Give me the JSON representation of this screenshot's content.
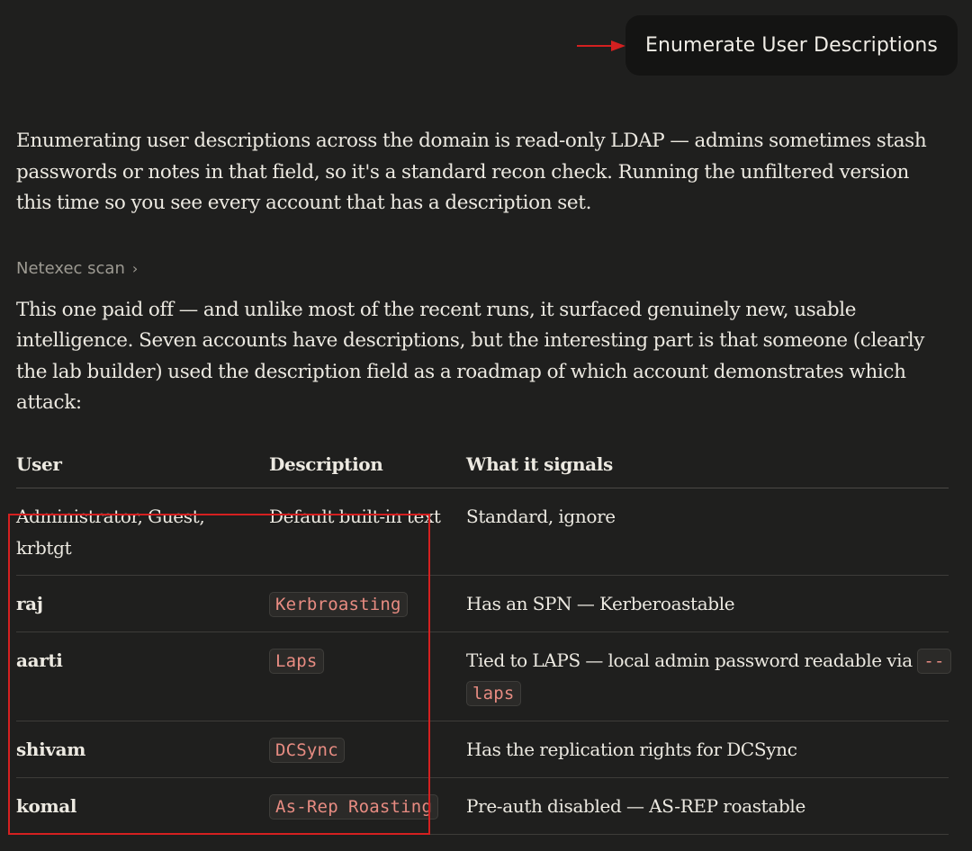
{
  "user_message": {
    "text": "Enumerate User Descriptions"
  },
  "assistant": {
    "intro": "Enumerating user descriptions across the domain is read-only LDAP — admins sometimes stash passwords or notes in that field, so it's a standard recon check. Running the unfiltered version this time so you see every account that has a description set.",
    "tool_call_label": "Netexec scan",
    "summary": "This one paid off — and unlike most of the recent runs, it surfaced genuinely new, usable intelligence. Seven accounts have descriptions, but the interesting part is that someone (clearly the lab builder) used the description field as a roadmap of which account demonstrates which attack:"
  },
  "table": {
    "headers": [
      "User",
      "Description",
      "What it signals"
    ],
    "rows": [
      {
        "user": "Administrator, Guest, krbtgt",
        "description": "Default built-in text",
        "signal": "Standard, ignore"
      },
      {
        "user": "raj",
        "description": "Kerbroasting",
        "signal": "Has an SPN — Kerberoastable"
      },
      {
        "user": "aarti",
        "description": "Laps",
        "signal_prefix": "Tied to LAPS — local admin password readable via ",
        "signal_code": "--laps"
      },
      {
        "user": "shivam",
        "description": "DCSync",
        "signal": "Has the replication rights for DCSync"
      },
      {
        "user": "komal",
        "description": "As-Rep Roasting",
        "signal": "Pre-auth disabled — AS-REP roastable"
      }
    ]
  },
  "colors": {
    "background": "#1f1f1e",
    "user_bubble": "#141413",
    "annotation_red": "#d42020",
    "code_text": "#e88c82"
  },
  "icons": {
    "annotation_arrow": "arrow-right-icon",
    "expand": "chevron-right-icon"
  }
}
